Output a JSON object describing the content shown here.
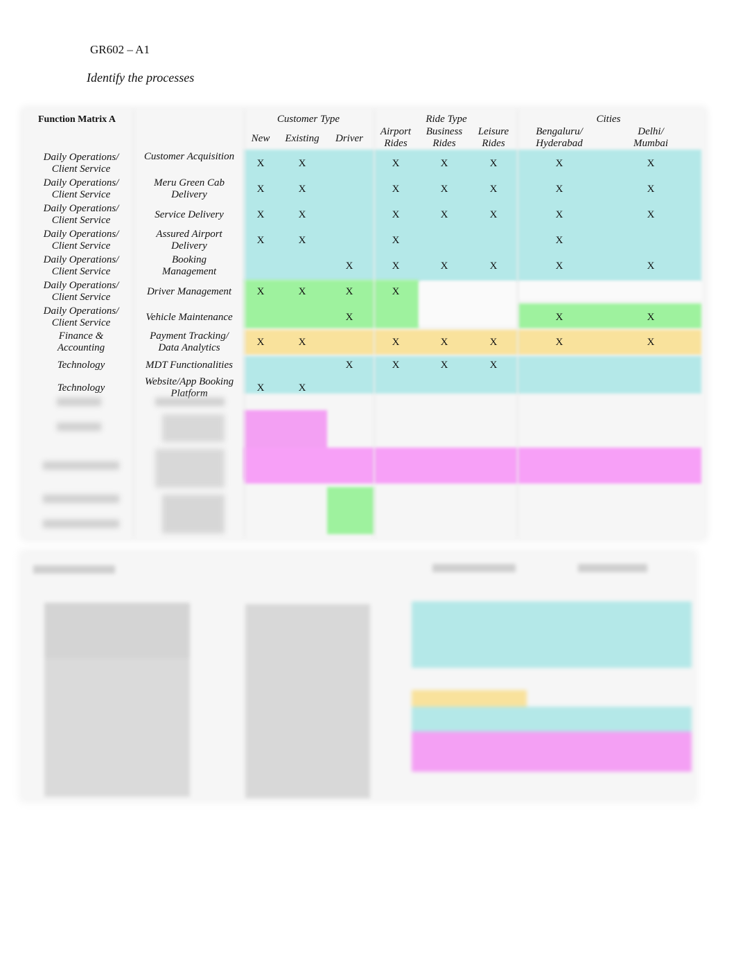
{
  "document": {
    "code": "GR602 – A1",
    "subtitle": "Identify the processes"
  },
  "matrix_a": {
    "title": "Function Matrix A",
    "groups": [
      {
        "label": "Customer Type",
        "columns": [
          "New",
          "Existing",
          "Driver"
        ]
      },
      {
        "label": "Ride Type",
        "columns": [
          "Airport Rides",
          "Business Rides",
          "Leisure Rides"
        ]
      },
      {
        "label": "Cities",
        "columns": [
          "Bengaluru/ Hyderabad",
          "Delhi/ Mumbai"
        ]
      }
    ],
    "column_labels": {
      "new": "New",
      "existing": "Existing",
      "driver": "Driver",
      "airport_1": "Airport",
      "airport_2": "Rides",
      "business_1": "Business",
      "business_2": "Rides",
      "leisure_1": "Leisure",
      "leisure_2": "Rides",
      "blr_1": "Bengaluru/",
      "blr_2": "Hyderabad",
      "del_1": "Delhi/",
      "del_2": "Mumbai"
    },
    "mark": "X",
    "colors": {
      "cyan": "#b4e8e8",
      "green": "#9ef29e",
      "yellow": "#f9e29c",
      "magenta": "#f7a0f7"
    },
    "rows": [
      {
        "function_1": "Daily Operations/",
        "function_2": "Client Service",
        "process_1": "Customer Acquisition",
        "process_2": "",
        "marks": [
          "X",
          "X",
          "",
          "X",
          "X",
          "X",
          "X",
          "X"
        ]
      },
      {
        "function_1": "Daily Operations/",
        "function_2": "Client Service",
        "process_1": "Meru Green Cab",
        "process_2": "Delivery",
        "marks": [
          "X",
          "X",
          "",
          "X",
          "X",
          "X",
          "X",
          "X"
        ]
      },
      {
        "function_1": "Daily Operations/",
        "function_2": "Client Service",
        "process_1": "Service Delivery",
        "process_2": "",
        "marks": [
          "X",
          "X",
          "",
          "X",
          "X",
          "X",
          "X",
          "X"
        ]
      },
      {
        "function_1": "Daily Operations/",
        "function_2": "Client Service",
        "process_1": "Assured Airport",
        "process_2": "Delivery",
        "marks": [
          "X",
          "X",
          "",
          "X",
          "",
          "",
          "X",
          ""
        ]
      },
      {
        "function_1": "Daily Operations/",
        "function_2": "Client Service",
        "process_1": "Booking",
        "process_2": "Management",
        "marks": [
          "",
          "",
          "X",
          "X",
          "X",
          "X",
          "X",
          "X"
        ]
      },
      {
        "function_1": "Daily Operations/",
        "function_2": "Client Service",
        "process_1": "Driver Management",
        "process_2": "",
        "marks": [
          "X",
          "X",
          "X",
          "X",
          "",
          "",
          "",
          ""
        ]
      },
      {
        "function_1": "Daily Operations/",
        "function_2": "Client Service",
        "process_1": "Vehicle Maintenance",
        "process_2": "",
        "marks": [
          "",
          "",
          "X",
          "",
          "",
          "",
          "X",
          "X"
        ]
      },
      {
        "function_1": "Finance &",
        "function_2": "Accounting",
        "process_1": "Payment Tracking/",
        "process_2": "Data Analytics",
        "marks": [
          "X",
          "X",
          "",
          "X",
          "X",
          "X",
          "X",
          "X"
        ]
      },
      {
        "function_1": "Technology",
        "function_2": "",
        "process_1": "MDT Functionalities",
        "process_2": "",
        "marks": [
          "",
          "",
          "X",
          "X",
          "X",
          "X",
          "",
          ""
        ]
      },
      {
        "function_1": "Technology",
        "function_2": "",
        "process_1": "Website/App Booking",
        "process_2": "Platform",
        "marks": [
          "X",
          "X",
          "",
          "",
          "",
          "",
          "",
          ""
        ]
      }
    ]
  }
}
